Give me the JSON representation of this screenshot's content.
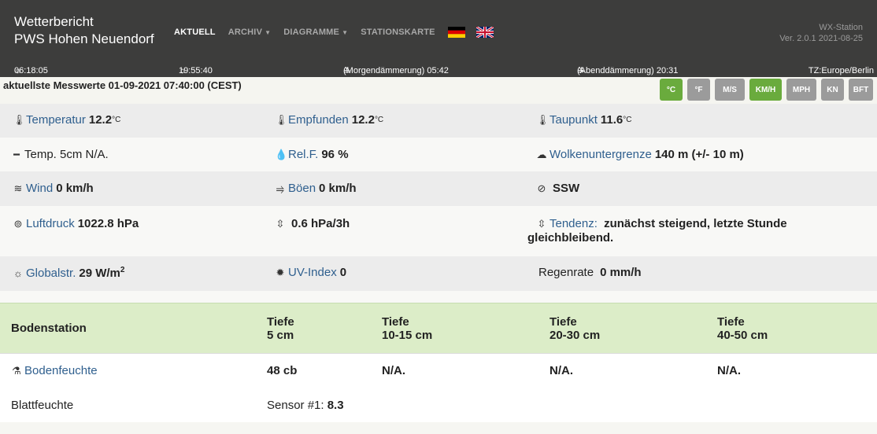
{
  "header": {
    "brand_line1": "Wetterbericht",
    "brand_line2": "PWS Hohen Neuendorf",
    "nav": {
      "aktuell": "AKTUELL",
      "archiv": "ARCHIV",
      "diagramme": "DIAGRAMME",
      "stationskarte": "STATIONSKARTE"
    },
    "station_name": "WX-Station",
    "station_version": "Ver. 2.0.1 2021-08-25",
    "sunrise": "06:18:05",
    "sunset": "19:55:40",
    "dawn": "(Morgendämmerung) 05:42",
    "dusk": "(Abenddämmerung) 20:31",
    "timezone": "TZ:Europe/Berlin"
  },
  "current": {
    "title": "aktuellste Messwerte  01-09-2021 07:40:00 (CEST)",
    "units": [
      "°C",
      "°F",
      "M/S",
      "KM/H",
      "MPH",
      "KN",
      "BFT"
    ],
    "active_units": [
      "°C",
      "KM/H"
    ]
  },
  "measurements": {
    "temp_label": "Temperatur",
    "temp_value": "12.2",
    "temp_unit": "°C",
    "felt_label": "Empfunden",
    "felt_value": "12.2",
    "felt_unit": "°C",
    "dew_label": "Taupunkt",
    "dew_value": "11.6",
    "dew_unit": "°C",
    "temp5_text": "Temp. 5cm N/A.",
    "hum_label": "Rel.F.",
    "hum_value": "96 %",
    "cloud_label": "Wolkenuntergrenze",
    "cloud_value": "140 m (+/- 10 m)",
    "wind_label": "Wind",
    "wind_value": "0 km/h",
    "gust_label": "Böen",
    "gust_value": "0 km/h",
    "dir_value": "SSW",
    "press_label": "Luftdruck",
    "press_value": "1022.8 hPa",
    "press_change": "0.6 hPa/3h",
    "trend_label": "Tendenz:",
    "trend_value_line1": "zunächst steigend, letzte Stunde",
    "trend_value_line2": "gleichbleibend.",
    "solar_label": "Globalstr.",
    "solar_value": "29 W/m",
    "solar_sup": "2",
    "uv_label": "UV-Index",
    "uv_value": "0",
    "rain_label": "Regenrate",
    "rain_value": "0 mm/h"
  },
  "boden": {
    "title": "Bodenstation",
    "depth_word": "Tiefe",
    "depths": [
      "5 cm",
      "10-15 cm",
      "20-30 cm",
      "40-50 cm"
    ],
    "moisture_label": "Bodenfeuchte",
    "moisture_values": [
      "48 cb",
      "N/A.",
      "N/A.",
      "N/A."
    ],
    "leaf_label": "Blattfeuchte",
    "leaf_sensor": "Sensor #1:",
    "leaf_value": "8.3"
  }
}
